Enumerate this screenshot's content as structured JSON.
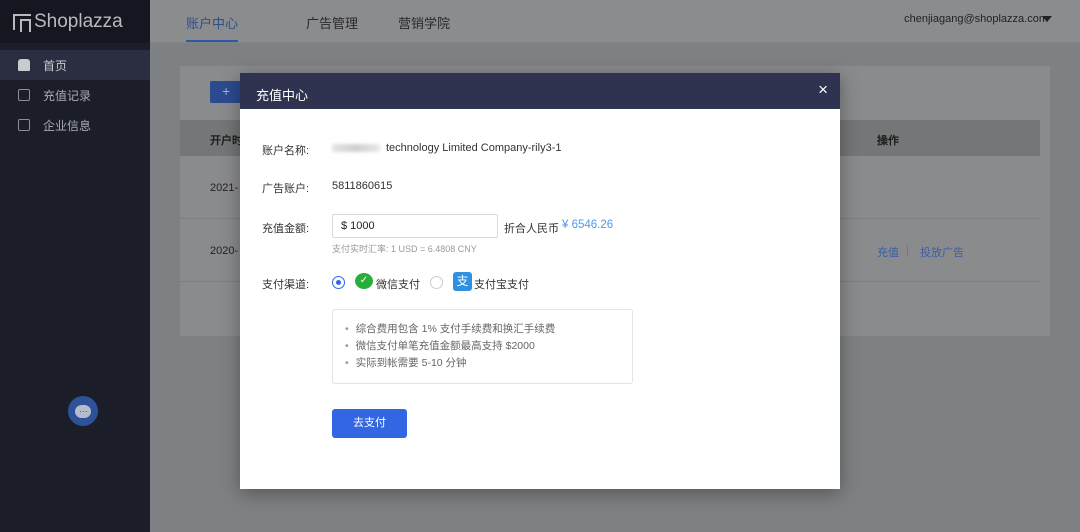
{
  "sidebar": {
    "logo": "Shoplazza",
    "items": [
      {
        "label": "首页"
      },
      {
        "label": "充值记录"
      },
      {
        "label": "企业信息"
      }
    ],
    "chat_icon": "…"
  },
  "header": {
    "tabs": [
      {
        "label": "账户中心"
      },
      {
        "label": "广告管理"
      },
      {
        "label": "营销学院"
      }
    ],
    "user": "chenjiagang@shoplazza.com"
  },
  "page": {
    "add_label": "+",
    "table_head": {
      "col1": "开户时",
      "col_action": "操作"
    },
    "rows": [
      {
        "date": "2021-"
      },
      {
        "date": "2020-",
        "actions": [
          "充值",
          "投放广告"
        ]
      }
    ]
  },
  "modal": {
    "title": "充值中心",
    "close": "×",
    "account_name_label": "账户名称:",
    "account_name": "technology Limited Company-rily3-1",
    "ad_account_label": "广告账户:",
    "ad_account": "5811860615",
    "amount_label": "充值金额:",
    "amount": "$ 1000",
    "cny_label": "折合人民币",
    "cny_value": "¥ 6546.26",
    "rate_note": "支付实时汇率: 1 USD = 6.4808 CNY",
    "channel_label": "支付渠道:",
    "channels": [
      {
        "label": "微信支付",
        "selected": true
      },
      {
        "label": "支付宝支付",
        "selected": false
      }
    ],
    "notes": [
      "综合费用包含 1% 支付手续费和换汇手续费",
      "微信支付单笔充值金额最高支持 $2000",
      "实际到帐需要 5-10 分钟"
    ],
    "pay_button": "去支付"
  },
  "colors": {
    "accent": "#3266e3",
    "cny": "#4a9ce8",
    "modal_header": "#2f3350"
  }
}
